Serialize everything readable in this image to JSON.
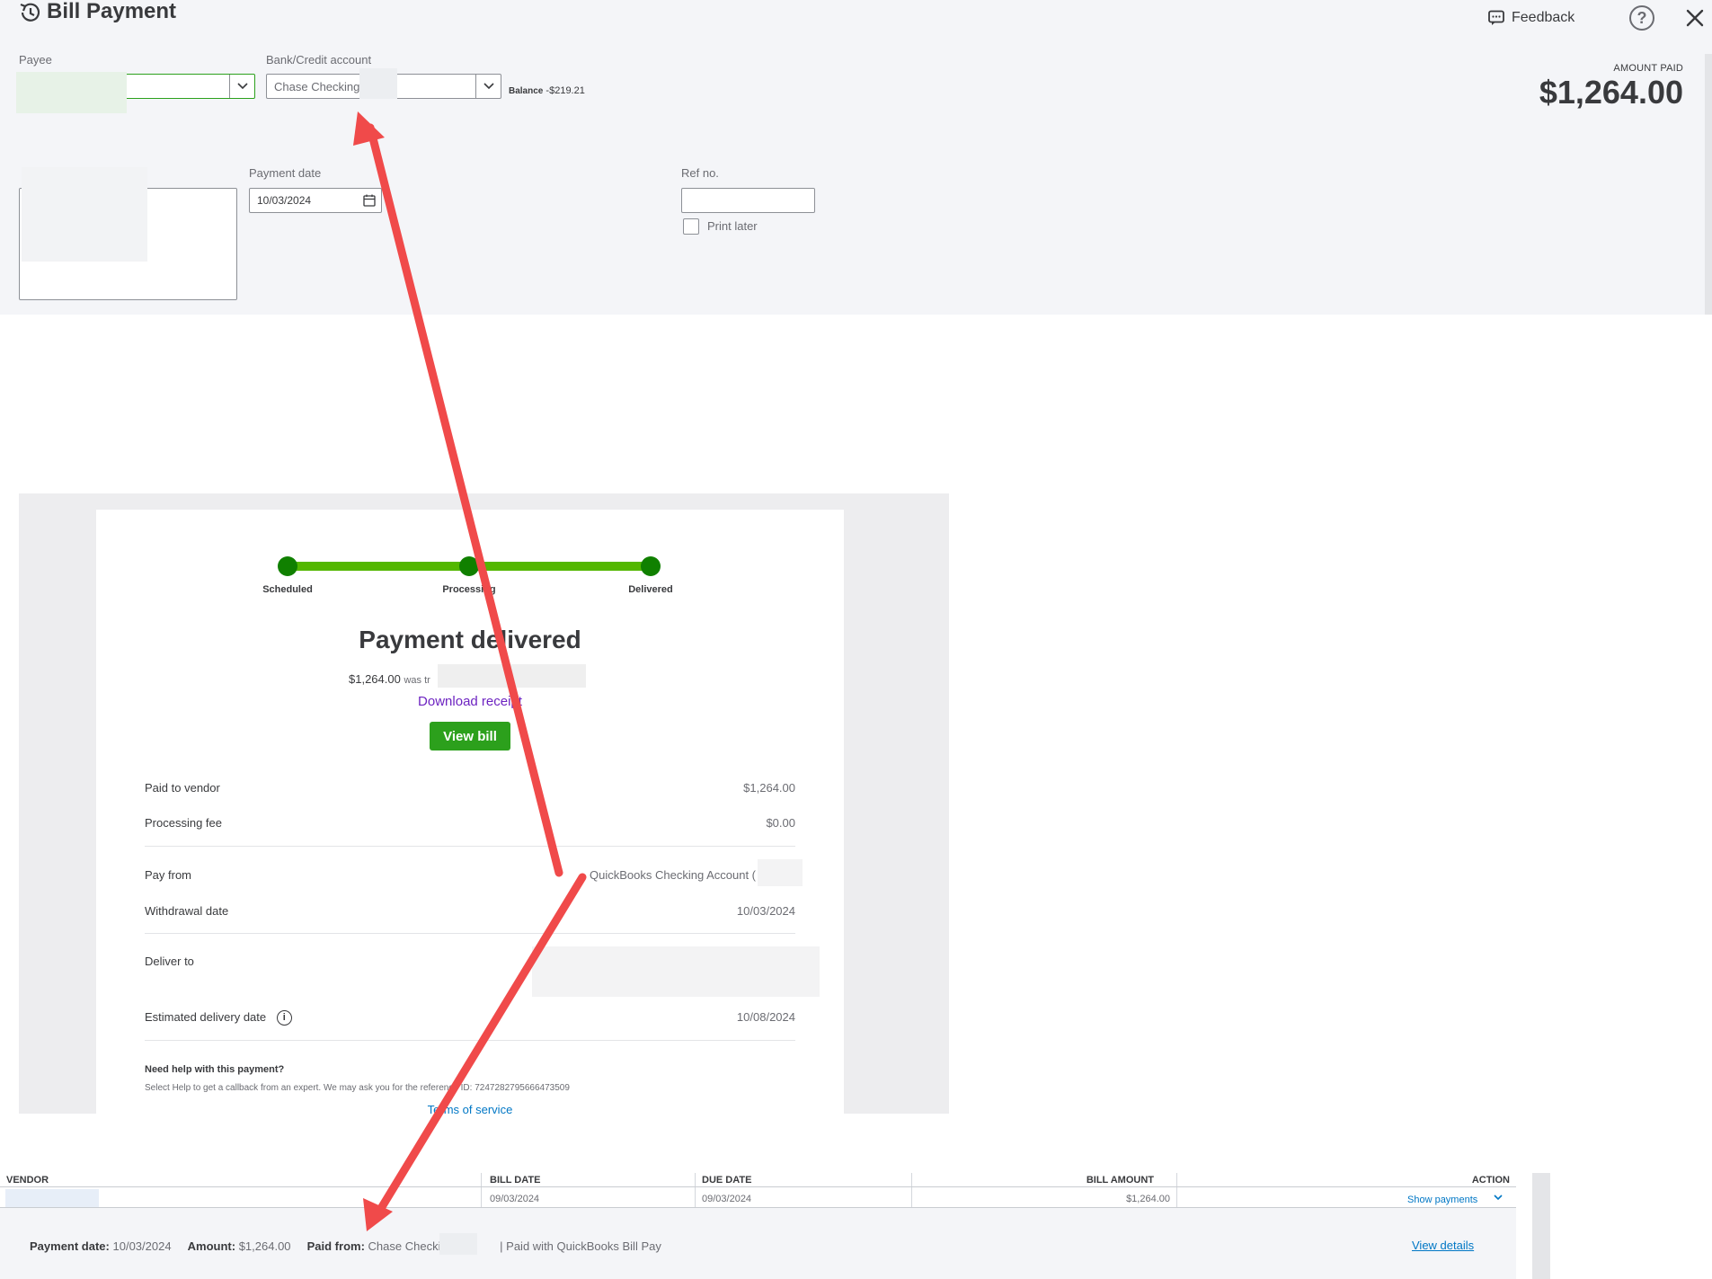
{
  "header": {
    "title": "Bill Payment",
    "feedback_label": "Feedback",
    "help_label": "?",
    "amount_paid_label": "AMOUNT PAID",
    "amount_paid_value": "$1,264.00"
  },
  "form": {
    "payee_label": "Payee",
    "bank_label": "Bank/Credit account",
    "bank_value": "Chase Checking",
    "balance_label": "Balance",
    "balance_value": "-$219.21",
    "payment_date_label": "Payment date",
    "payment_date_value": "10/03/2024",
    "ref_label": "Ref no.",
    "print_later_label": "Print later"
  },
  "receipt": {
    "steps": [
      "Scheduled",
      "Processing",
      "Delivered"
    ],
    "status_title": "Payment delivered",
    "status_amount": "$1,264.00",
    "status_sub": "was tr",
    "download_receipt": "Download receipt",
    "view_bill": "View bill",
    "rows": {
      "paid_to_vendor_label": "Paid to vendor",
      "paid_to_vendor_value": "$1,264.00",
      "processing_fee_label": "Processing fee",
      "processing_fee_value": "$0.00",
      "pay_from_label": "Pay from",
      "pay_from_value": "QuickBooks Checking Account (",
      "withdrawal_date_label": "Withdrawal date",
      "withdrawal_date_value": "10/03/2024",
      "deliver_to_label": "Deliver to",
      "estimated_delivery_label": "Estimated delivery date",
      "estimated_delivery_value": "10/08/2024"
    },
    "help_title": "Need help with this payment?",
    "help_text": "Select Help to get a callback from an expert. We may ask you for the reference ID: 7247282795666473509",
    "terms": "Terms of service"
  },
  "table": {
    "columns": [
      "VENDOR",
      "BILL DATE",
      "DUE DATE",
      "BILL AMOUNT",
      "ACTION"
    ],
    "row": {
      "bill_date": "09/03/2024",
      "due_date": "09/03/2024",
      "bill_amount": "$1,264.00",
      "action": "Show payments"
    },
    "footer": {
      "payment_date_label": "Payment date:",
      "payment_date_value": "10/03/2024",
      "amount_label": "Amount:",
      "amount_value": "$1,264.00",
      "paid_from_label": "Paid from:",
      "paid_from_value": "Chase Checking",
      "paid_with": "| Paid with QuickBooks Bill Pay",
      "view_details": "View details"
    }
  },
  "colors": {
    "brand_green": "#2ca01c",
    "progress_green": "#53b700",
    "link_blue": "#0077c5",
    "link_purple": "#6d23c1",
    "annotation_red": "#f04a4a"
  },
  "icons": [
    "history-icon",
    "feedback-icon",
    "help-icon",
    "close-icon",
    "chevron-down-icon",
    "calendar-icon",
    "info-icon"
  ]
}
